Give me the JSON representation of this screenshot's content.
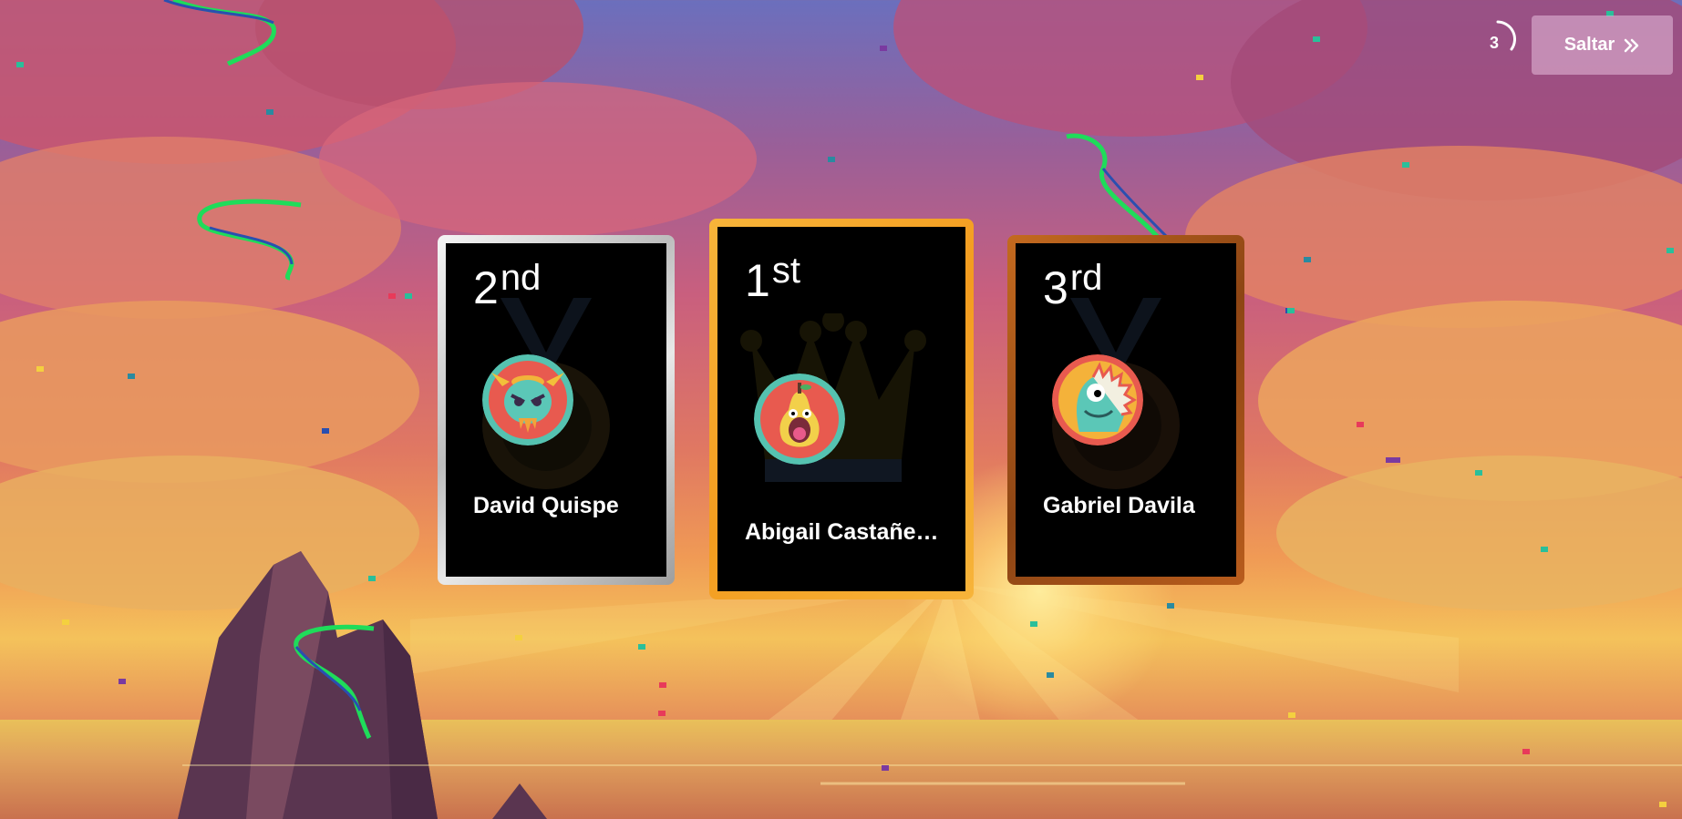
{
  "countdown": {
    "value": "3"
  },
  "skip_button": {
    "label": "Saltar",
    "icon": "double-chevron-right-icon"
  },
  "podium": [
    {
      "place": "second",
      "rank_number": "2",
      "rank_suffix": "nd",
      "name": "David Quispe",
      "avatar": "horned-skull-monster-avatar",
      "frame_color": "#c0c0c0"
    },
    {
      "place": "first",
      "rank_number": "1",
      "rank_suffix": "st",
      "name": "Abigail Castañe…",
      "avatar": "pear-monster-avatar",
      "frame_color": "#f5a623"
    },
    {
      "place": "third",
      "rank_number": "3",
      "rank_suffix": "rd",
      "name": "Gabriel Davila",
      "avatar": "dinosaur-monster-avatar",
      "frame_color": "#a0521a"
    }
  ],
  "colors": {
    "gold": "#f5a623",
    "silver": "#c0c0c0",
    "bronze": "#a0521a",
    "card_bg": "#000000"
  }
}
